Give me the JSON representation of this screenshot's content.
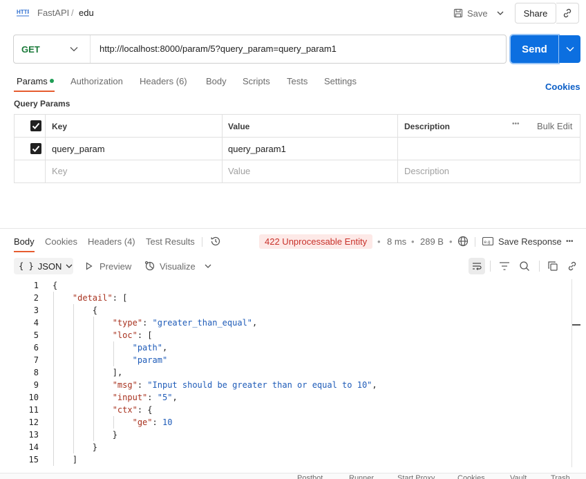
{
  "breadcrumb": {
    "collection": "FastAPI",
    "separator": "/",
    "request": "edu"
  },
  "header": {
    "save_label": "Save",
    "share_label": "Share"
  },
  "request": {
    "method": "GET",
    "url": "http://localhost:8000/param/5?query_param=query_param1",
    "send_label": "Send"
  },
  "request_tabs": {
    "params": "Params",
    "authorization": "Authorization",
    "headers": "Headers (6)",
    "body": "Body",
    "scripts": "Scripts",
    "tests": "Tests",
    "settings": "Settings",
    "cookies": "Cookies"
  },
  "query_params": {
    "title": "Query Params",
    "headers": {
      "key": "Key",
      "value": "Value",
      "description": "Description",
      "bulk_edit": "Bulk Edit",
      "more": "•••"
    },
    "rows": [
      {
        "key": "query_param",
        "value": "query_param1",
        "description": "",
        "checked": true
      }
    ],
    "placeholders": {
      "key": "Key",
      "value": "Value",
      "description": "Description"
    }
  },
  "response_tabs": {
    "body": "Body",
    "cookies": "Cookies",
    "headers": "Headers (4)",
    "test_results": "Test Results"
  },
  "response_meta": {
    "status": "422 Unprocessable Entity",
    "time": "8 ms",
    "size": "289 B",
    "save_response": "Save Response",
    "more": "•••",
    "dot": "•"
  },
  "response_toolbar": {
    "format": "JSON",
    "preview": "Preview",
    "visualize": "Visualize"
  },
  "code_lines": [
    "{",
    "    \"detail\": [",
    "        {",
    "            \"type\": \"greater_than_equal\",",
    "            \"loc\": [",
    "                \"path\",",
    "                \"param\"",
    "            ],",
    "            \"msg\": \"Input should be greater than or equal to 10\",",
    "            \"input\": \"5\",",
    "            \"ctx\": {",
    "                \"ge\": 10",
    "            }",
    "        }",
    "    ]"
  ],
  "footer": [
    "Postbot",
    "Runner",
    "Start Proxy",
    "Cookies",
    "Vault",
    "Trash"
  ],
  "colors": {
    "accent": "#0c6fe0",
    "method_get": "#1b7a3a",
    "error": "#c8312a",
    "tab_underline": "#e65c2f"
  }
}
